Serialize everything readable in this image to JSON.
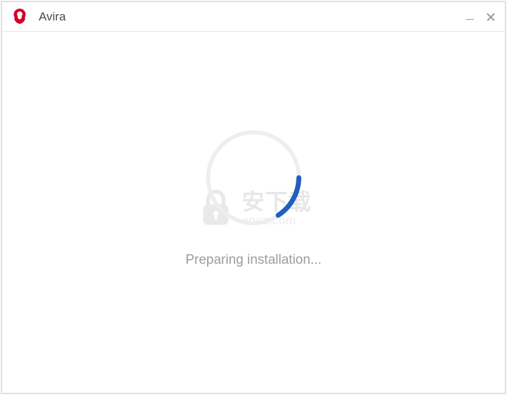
{
  "window": {
    "title": "Avira"
  },
  "status": {
    "message": "Preparing installation..."
  },
  "brand": {
    "color": "#d40027"
  },
  "watermark": {
    "cn": "安下载",
    "en": "anxz.com"
  }
}
